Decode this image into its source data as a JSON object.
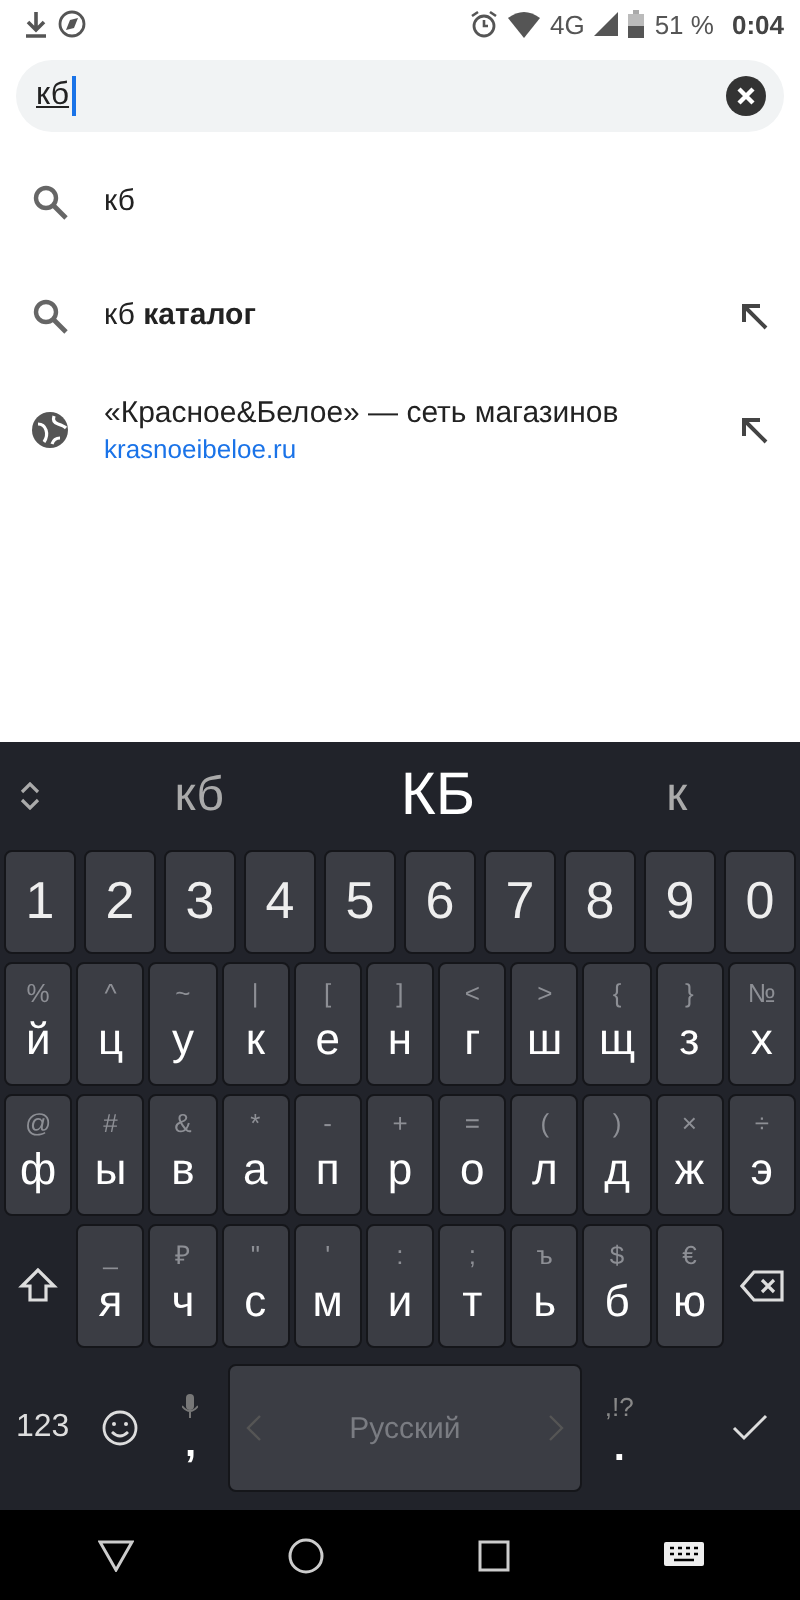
{
  "status_bar": {
    "network": "4G",
    "battery": "51 %",
    "time": "0:04"
  },
  "search": {
    "value": "кб"
  },
  "suggestions": [
    {
      "kind": "query",
      "text": "кб",
      "fill_arrow": false
    },
    {
      "kind": "query",
      "text": "кб **каталог**",
      "fill_arrow": true
    },
    {
      "kind": "site",
      "text": "«Красное&Белое» — сеть магазинов",
      "url": "krasnoeibeloe.ru",
      "fill_arrow": true
    }
  ],
  "candidates": [
    {
      "text": "кб",
      "selected": false
    },
    {
      "text": "КБ",
      "selected": true
    },
    {
      "text": "к",
      "selected": false
    }
  ],
  "keyboard": {
    "number_row": [
      "1",
      "2",
      "3",
      "4",
      "5",
      "6",
      "7",
      "8",
      "9",
      "0"
    ],
    "upper_letters": [
      {
        "main": "й",
        "alt": "%"
      },
      {
        "main": "ц",
        "alt": "^"
      },
      {
        "main": "у",
        "alt": "~"
      },
      {
        "main": "к",
        "alt": "|"
      },
      {
        "main": "е",
        "alt": "["
      },
      {
        "main": "н",
        "alt": "]"
      },
      {
        "main": "г",
        "alt": "<"
      },
      {
        "main": "ш",
        "alt": ">"
      },
      {
        "main": "щ",
        "alt": "{"
      },
      {
        "main": "з",
        "alt": "}"
      },
      {
        "main": "х",
        "alt": "№"
      }
    ],
    "middle_letters": [
      {
        "main": "ф",
        "alt": "@"
      },
      {
        "main": "ы",
        "alt": "#"
      },
      {
        "main": "в",
        "alt": "&"
      },
      {
        "main": "а",
        "alt": "*"
      },
      {
        "main": "п",
        "alt": "-"
      },
      {
        "main": "р",
        "alt": "+"
      },
      {
        "main": "о",
        "alt": "="
      },
      {
        "main": "л",
        "alt": "("
      },
      {
        "main": "д",
        "alt": ")"
      },
      {
        "main": "ж",
        "alt": "×"
      },
      {
        "main": "э",
        "alt": "÷"
      }
    ],
    "lower_letters": [
      {
        "main": "я",
        "alt": "_"
      },
      {
        "main": "ч",
        "alt": "₽"
      },
      {
        "main": "с",
        "alt": "\""
      },
      {
        "main": "м",
        "alt": "'"
      },
      {
        "main": "и",
        "alt": ":"
      },
      {
        "main": "т",
        "alt": ";"
      },
      {
        "main": "ь",
        "alt": "ъ"
      },
      {
        "main": "б",
        "alt": "$"
      },
      {
        "main": "ю",
        "alt": "€"
      }
    ],
    "symbols_key": "123",
    "comma": ",",
    "space": "Русский",
    "period": ".",
    "period_alt": ",!?"
  }
}
